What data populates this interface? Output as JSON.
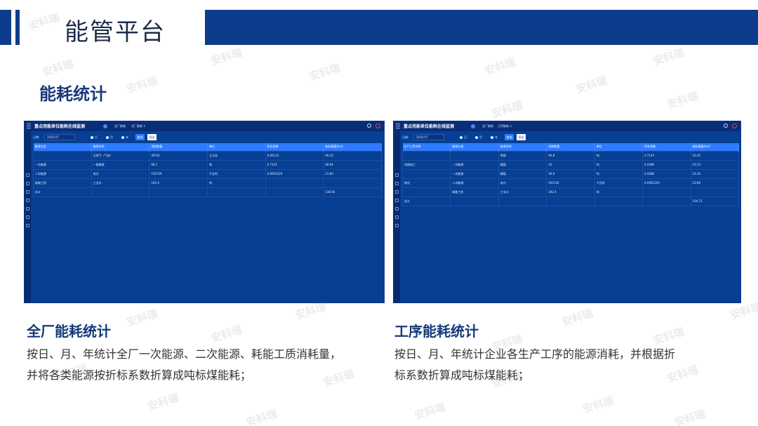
{
  "page": {
    "title": "能管平台",
    "section_title": "能耗统计",
    "watermark": "安科瑞"
  },
  "left": {
    "heading": "全厂能耗统计",
    "desc_lines": [
      "按日、月、年统计全厂一次能源、二次能源、耗能工质消耗量，",
      "并将各类能源按折标系数折算成吨标煤能耗；"
    ],
    "panel": {
      "title": "重点用能单位能耗在线监测",
      "tabs": [
        "全厂能耗",
        "全厂能耗 ×"
      ],
      "filter": {
        "date_label": "日期:",
        "date_value": "2020-07",
        "radios": [
          "日",
          "月",
          "年"
        ],
        "query": "查询",
        "export": "导出"
      },
      "headers": [
        "能源分类",
        "能源名称",
        "消耗数量",
        "单位",
        "折标系数",
        "耗标煤量(tce)"
      ],
      "rows": [
        [
          "",
          "天然气（气态）",
          "49741",
          "立方米",
          "0.00133",
          "66.16"
        ],
        [
          "一次能源",
          "一般燃煤",
          "68.1",
          "吨",
          "0.7143",
          "48.64"
        ],
        [
          "二次能源",
          "电力",
          "193726",
          "千瓦时",
          "0.0001229",
          "23.80"
        ],
        [
          "耗能工质",
          "工业水",
          "192.4",
          "吨",
          "",
          ""
        ],
        [
          "总计",
          "",
          "",
          "",
          "",
          "138.60"
        ]
      ]
    }
  },
  "right": {
    "heading": "工序能耗统计",
    "desc_lines": [
      "按日、月、年统计企业各生产工序的能源消耗，并根据折",
      "标系数折算成吨标煤能耗；"
    ],
    "panel": {
      "title": "重点用能单位能耗在线监测",
      "tabs": [
        "全厂能耗",
        "工序能耗 ×"
      ],
      "filter": {
        "date_label": "日期:",
        "date_value": "2020-07",
        "radios": [
          "日",
          "月",
          "年"
        ],
        "query": "查询",
        "export": "导出"
      },
      "headers": [
        "生产工序名称",
        "能源分类",
        "能源名称",
        "消耗数量",
        "单位",
        "折标系数",
        "耗标煤量(tce)"
      ],
      "rows": [
        [
          "",
          "",
          "原煤",
          "46.8",
          "吨",
          "0.7143",
          "33.42"
        ],
        [
          "机械加工",
          "一次能源",
          "精煤",
          "24",
          "吨",
          "0.4286",
          "10.14"
        ],
        [
          "",
          "一次能源",
          "精煤",
          "36.9",
          "吨",
          "0.4286",
          "24.34"
        ],
        [
          "焦化",
          "二次能源",
          "电力",
          "193726",
          "千瓦时",
          "0.0001229",
          "23.80"
        ],
        [
          "",
          "耗能工质",
          "工业水",
          "192.4",
          "吨",
          "",
          ""
        ],
        [
          "总计",
          "",
          "",
          "",
          "",
          "",
          "104.72"
        ]
      ]
    }
  }
}
